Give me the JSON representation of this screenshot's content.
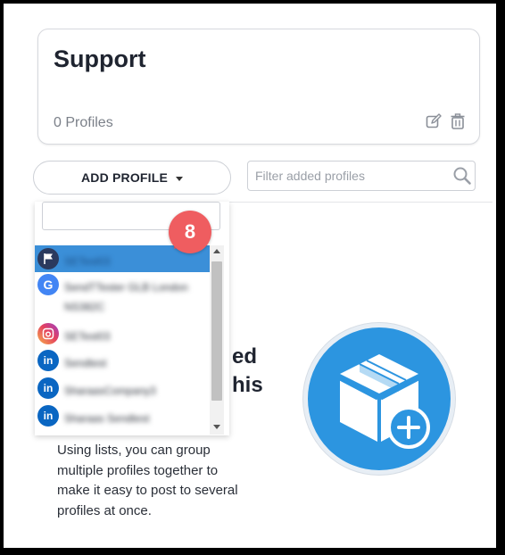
{
  "list": {
    "title": "Support",
    "profiles_count": "0 Profiles"
  },
  "toolbar": {
    "add_profile_label": "ADD PROFILE",
    "filter_placeholder": "Filter added profiles"
  },
  "dropdown": {
    "search_value": "",
    "items": [
      {
        "name": "SETest03",
        "network": "flag",
        "selected": true
      },
      {
        "name": "SendTTester GLB London NS382C",
        "network": "google",
        "selected": false
      },
      {
        "name": "SETest03",
        "network": "instagram",
        "selected": false
      },
      {
        "name": "Sendtest",
        "network": "linkedin",
        "selected": false
      },
      {
        "name": "SharaasCompany3",
        "network": "linkedin",
        "selected": false
      },
      {
        "name": "Sharaas Sendtest",
        "network": "linkedin",
        "selected": false
      }
    ]
  },
  "badge": {
    "step": "8"
  },
  "empty_state": {
    "heading_line1": "ed",
    "heading_line2": "his",
    "description": "Using lists, you can group multiple profiles together to make it easy to post to several profiles at once."
  },
  "colors": {
    "accent": "#2c95e0",
    "selected_row": "#3b8fd8",
    "badge": "#ef5d60",
    "linkedin": "#0a66c2"
  },
  "icons": {
    "edit": "edit-icon",
    "trash": "trash-icon",
    "search": "search-icon",
    "caret": "caret-down-icon",
    "hero": "box-add-icon"
  }
}
